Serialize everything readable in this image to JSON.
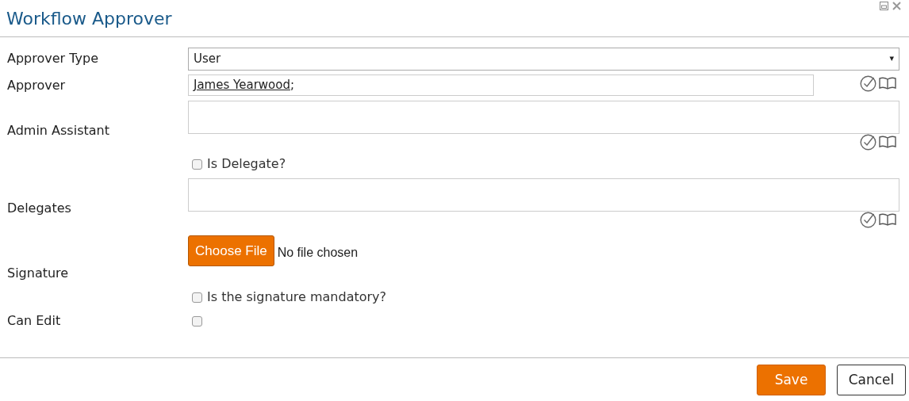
{
  "window": {
    "title": "Workflow Approver"
  },
  "fields": [
    {
      "kind": "select",
      "label": "Approver Type",
      "value": "User",
      "caret": "▾"
    },
    {
      "kind": "people",
      "label": "Approver",
      "values": [
        "James Yearwood"
      ],
      "separator": ";"
    },
    {
      "kind": "people_multi",
      "label": "Admin Assistant"
    },
    {
      "kind": "checkbox",
      "label": "Is Delegate?",
      "checked": false
    },
    {
      "kind": "people_multi",
      "label": "Delegates"
    },
    {
      "kind": "file",
      "label": "Signature",
      "button": "Choose File",
      "status": "No file chosen"
    },
    {
      "kind": "checkbox",
      "label": "Is the signature mandatory?",
      "checked": false
    },
    {
      "kind": "checkbox_labeled",
      "label": "Can Edit",
      "checked": false
    }
  ],
  "buttons": [
    {
      "label": "Save",
      "kind": "primary"
    },
    {
      "label": "Cancel",
      "kind": "secondary"
    }
  ]
}
